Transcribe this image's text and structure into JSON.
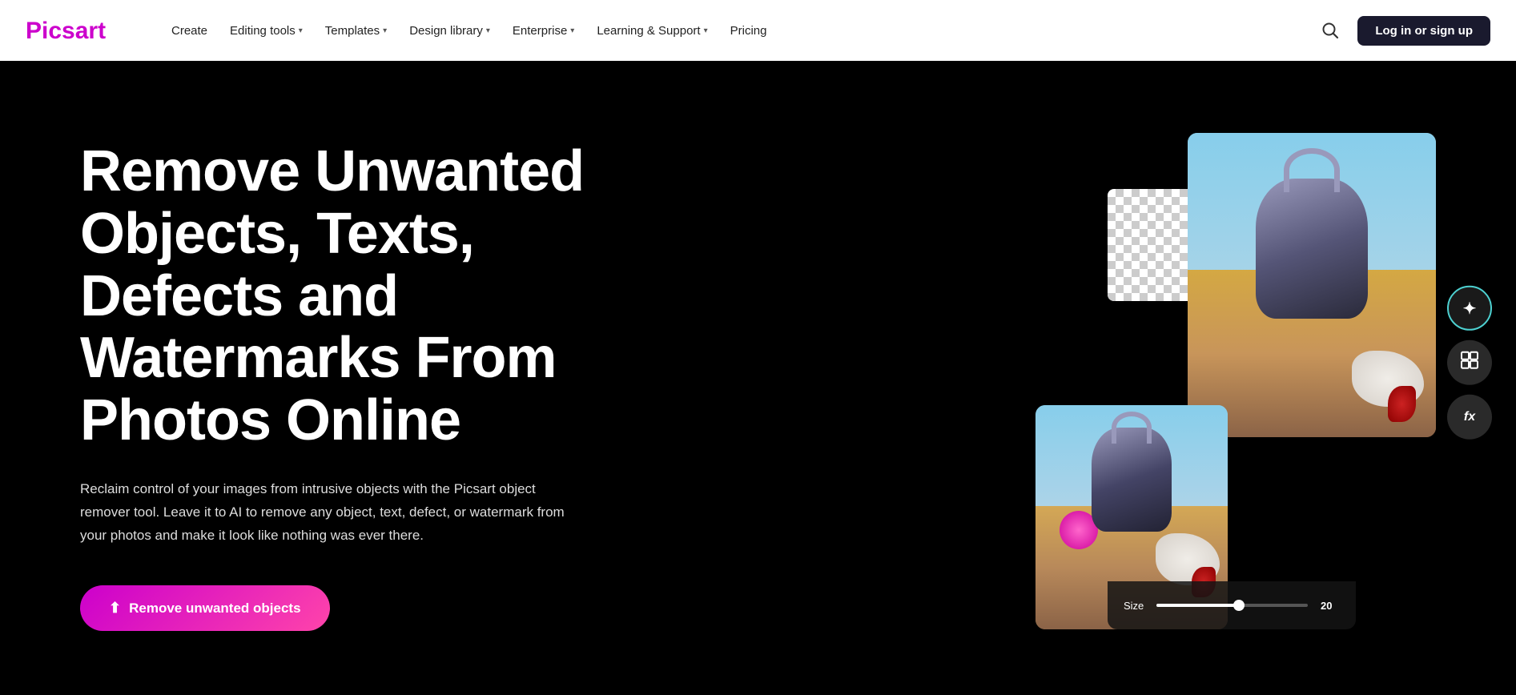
{
  "navbar": {
    "logo": "Picsart",
    "links": [
      {
        "label": "Create",
        "hasDropdown": false
      },
      {
        "label": "Editing tools",
        "hasDropdown": true
      },
      {
        "label": "Templates",
        "hasDropdown": true
      },
      {
        "label": "Design library",
        "hasDropdown": true
      },
      {
        "label": "Enterprise",
        "hasDropdown": true
      },
      {
        "label": "Learning & Support",
        "hasDropdown": true
      },
      {
        "label": "Pricing",
        "hasDropdown": false
      }
    ],
    "login_label": "Log in or sign up"
  },
  "hero": {
    "title": "Remove Unwanted Objects, Texts, Defects and Watermarks From Photos Online",
    "subtitle": "Reclaim control of your images from intrusive objects with the Picsart object remover tool. Leave it to AI to remove any object, text, defect, or watermark from your photos and make it look like nothing was ever there.",
    "cta_label": "Remove unwanted objects"
  },
  "tools": [
    {
      "name": "magic-eraser",
      "label": "✦"
    },
    {
      "name": "layout",
      "label": "⊞"
    },
    {
      "name": "fx",
      "label": "fx"
    }
  ],
  "size_slider": {
    "label": "Size",
    "value": "20"
  }
}
